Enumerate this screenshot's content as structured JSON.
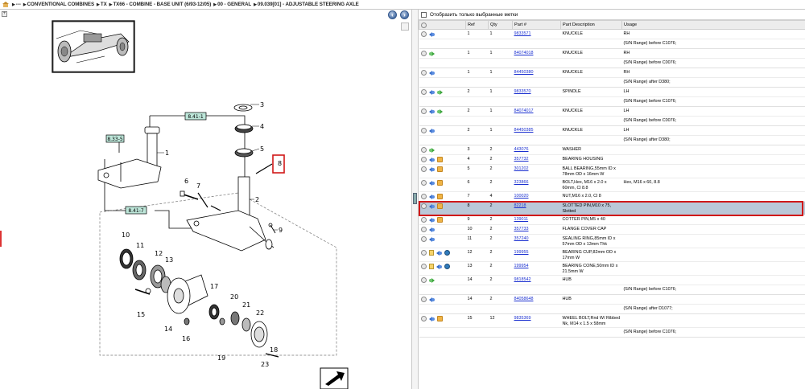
{
  "breadcrumb": {
    "items": [
      "---",
      "CONVENTIONAL COMBINES",
      "TX",
      "TX66 - COMBINE - BASE UNIT (6/93-12/05)",
      "00 - GENERAL",
      "09.039[01] - ADJUSTABLE STEERING AXLE"
    ]
  },
  "filter": {
    "label": "Отобразить только выбранные метки",
    "checked": false
  },
  "table": {
    "columns": [
      "Ref",
      "Qty",
      "Part #",
      "Part Description",
      "Usage"
    ],
    "rows": [
      {
        "icons": [
          "gear-icon",
          "back-arrow-icon"
        ],
        "ref": "1",
        "qty": "1",
        "part": "9833571",
        "desc": "KNUCKLE",
        "usage": "RH",
        "sub": "(S/N Range) before C1076;"
      },
      {
        "icons": [
          "gear-icon",
          "forward-arrow-icon"
        ],
        "ref": "1",
        "qty": "1",
        "part": "84074018",
        "desc": "KNUCKLE",
        "usage": "RH",
        "sub": "(S/N Range) before C0076;"
      },
      {
        "icons": [
          "gear-icon",
          "back-arrow-icon"
        ],
        "ref": "1",
        "qty": "1",
        "part": "84450380",
        "desc": "KNUCKLE",
        "usage": "RH",
        "sub": "(S/N Range) after D380;"
      },
      {
        "icons": [
          "gear-icon",
          "back-arrow-icon",
          "forward-arrow-icon"
        ],
        "ref": "2",
        "qty": "1",
        "part": "9833570",
        "desc": "SPINDLE",
        "usage": "LH",
        "sub": "(S/N Range) before C1076;"
      },
      {
        "icons": [
          "gear-icon",
          "back-arrow-icon",
          "forward-arrow-icon"
        ],
        "ref": "2",
        "qty": "1",
        "part": "84074017",
        "desc": "KNUCKLE",
        "usage": "LH",
        "sub": "(S/N Range) before C0076;"
      },
      {
        "icons": [
          "gear-icon",
          "back-arrow-icon"
        ],
        "ref": "2",
        "qty": "1",
        "part": "84450385",
        "desc": "KNUCKLE",
        "usage": "LH",
        "sub": "(S/N Range) after D380;"
      },
      {
        "icons": [
          "gear-icon",
          "forward-arrow-icon"
        ],
        "ref": "3",
        "qty": "2",
        "part": "443076",
        "desc": "WASHER",
        "usage": ""
      },
      {
        "icons": [
          "gear-icon",
          "back-arrow-icon",
          "box-icon"
        ],
        "ref": "4",
        "qty": "2",
        "part": "357732",
        "desc": "BEARING HOUSING",
        "usage": ""
      },
      {
        "icons": [
          "gear-icon",
          "back-arrow-icon",
          "box-icon"
        ],
        "ref": "5",
        "qty": "2",
        "part": "301202",
        "desc": "BALL BEARING,55mm ID x 78mm OD x 16mm W",
        "usage": ""
      },
      {
        "icons": [
          "gear-icon",
          "back-arrow-icon",
          "box-icon"
        ],
        "ref": "6",
        "qty": "2",
        "part": "323866",
        "desc": "BOLT,Hex, M16 x 2.0 x 60mm, Cl 8.8",
        "usage": "Hex, M16 x 60, 8.8"
      },
      {
        "icons": [
          "gear-icon",
          "back-arrow-icon",
          "box-icon"
        ],
        "ref": "7",
        "qty": "4",
        "part": "100020",
        "desc": "NUT,M16 x 2.0, Cl 8",
        "usage": ""
      },
      {
        "icons": [
          "gear-icon",
          "back-arrow-icon",
          "box-icon"
        ],
        "ref": "8",
        "qty": "2",
        "part": "82218",
        "desc": "SLOTTED PIN,M10 x 75, Slotted",
        "usage": "",
        "selected": true
      },
      {
        "icons": [
          "gear-icon",
          "back-arrow-icon",
          "box-icon"
        ],
        "ref": "9",
        "qty": "2",
        "part": "139011",
        "desc": "COTTER PIN,M5 x 40",
        "usage": ""
      },
      {
        "icons": [
          "gear-icon",
          "back-arrow-icon"
        ],
        "ref": "10",
        "qty": "2",
        "part": "357733",
        "desc": "FLANGE COVER CAP",
        "usage": ""
      },
      {
        "icons": [
          "gear-icon",
          "back-arrow-icon"
        ],
        "ref": "11",
        "qty": "2",
        "part": "357240",
        "desc": "SEALING RING,85mm ID x 57mm OD x 13mm Thk",
        "usage": ""
      },
      {
        "icons": [
          "gear-icon",
          "doc-icon",
          "back-arrow-icon",
          "blue-dot-icon"
        ],
        "ref": "12",
        "qty": "2",
        "part": "199955",
        "desc": "BEARING CUP,82mm OD x 17mm W",
        "usage": ""
      },
      {
        "icons": [
          "gear-icon",
          "doc-icon",
          "back-arrow-icon",
          "blue-dot-icon"
        ],
        "ref": "13",
        "qty": "2",
        "part": "199954",
        "desc": "BEARING CONE,50mm ID x 21.5mm W",
        "usage": ""
      },
      {
        "icons": [
          "gear-icon",
          "forward-arrow-icon"
        ],
        "ref": "14",
        "qty": "2",
        "part": "9818542",
        "desc": "HUB",
        "usage": "",
        "sub": "(S/N Range) before C1076;"
      },
      {
        "icons": [
          "gear-icon",
          "back-arrow-icon"
        ],
        "ref": "14",
        "qty": "2",
        "part": "84058648",
        "desc": "HUB",
        "usage": "",
        "sub": "(S/N Range) after D1077;"
      },
      {
        "icons": [
          "gear-icon",
          "back-arrow-icon",
          "box-icon"
        ],
        "ref": "15",
        "qty": "12",
        "part": "9835369",
        "desc": "WHEEL BOLT,Rnd W/ Ribbed Nk, M14 x 1.5 x 58mm",
        "usage": "",
        "sub": "(S/N Range) before C1076;"
      }
    ]
  },
  "diagram": {
    "callouts": [
      "1",
      "2",
      "3",
      "4",
      "5",
      "6",
      "7",
      "8",
      "9",
      "10",
      "11",
      "12",
      "13",
      "14",
      "15",
      "16",
      "17",
      "18",
      "19",
      "20",
      "21",
      "22",
      "23"
    ],
    "ref_tags": [
      "8.41-1",
      "8.33-5",
      "8.41-7"
    ]
  }
}
